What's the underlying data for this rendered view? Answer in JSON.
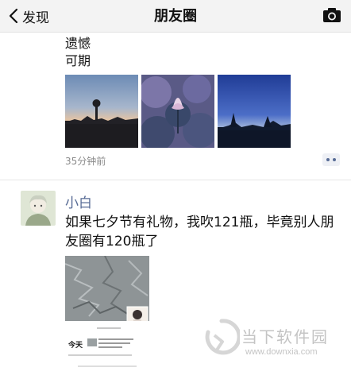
{
  "nav": {
    "back_label": "发现",
    "title": "朋友圈"
  },
  "post1": {
    "text_lines": [
      "遗憾",
      "可期"
    ],
    "time": "35分钟前"
  },
  "post2": {
    "user_name": "小白",
    "text": "如果七夕节有礼物，我吹121瓶，毕竟别人朋友圈有120瓶了",
    "screenshot": {
      "heading": "今天",
      "caption": "如果七夕节有礼物，我吹121瓶，毕竟别人朋友圈有120瓶了"
    }
  },
  "watermark": {
    "title": "当下软件园",
    "url": "www.downxia.com"
  },
  "colors": {
    "accent": "#576b95",
    "nav_bg": "#f3f3f3",
    "muted": "#8a8a8a"
  }
}
